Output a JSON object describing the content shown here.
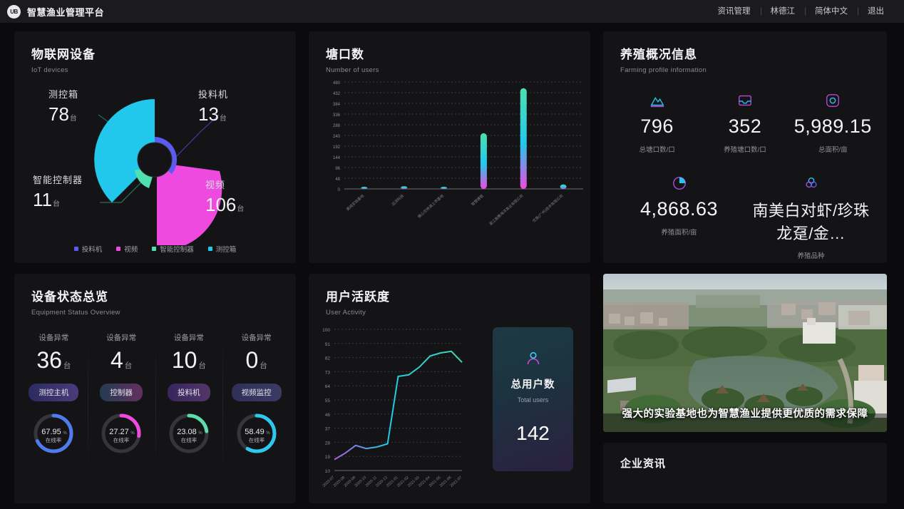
{
  "topbar": {
    "logo_text": "UB",
    "title": "智慧渔业管理平台",
    "nav": [
      {
        "label": "资讯管理",
        "name": "nav-news-management"
      },
      {
        "label": "林德江",
        "name": "nav-user-name"
      },
      {
        "label": "简体中文",
        "name": "nav-language"
      },
      {
        "label": "退出",
        "name": "nav-logout"
      }
    ]
  },
  "iot": {
    "title": "物联网设备",
    "subtitle": "IoT devices",
    "unit": "台",
    "labels": [
      {
        "name": "测控箱",
        "value": "78"
      },
      {
        "name": "投料机",
        "value": "13"
      },
      {
        "name": "智能控制器",
        "value": "11"
      },
      {
        "name": "视频",
        "value": "106"
      }
    ],
    "legend": [
      {
        "label": "投料机",
        "color": "#5b5bf0"
      },
      {
        "label": "视频",
        "color": "#ef4ae0"
      },
      {
        "label": "智能控制器",
        "color": "#4fe0b0"
      },
      {
        "label": "测控箱",
        "color": "#22c8ec"
      }
    ],
    "chart_data": {
      "type": "pie",
      "title": "物联网设备 / IoT devices",
      "labels": [
        "测控箱",
        "视频",
        "投料机",
        "智能控制器"
      ],
      "values": [
        78,
        106,
        13,
        11
      ],
      "unit": "台",
      "colors": [
        "#22c8ec",
        "#ef4ae0",
        "#5b5bf0",
        "#4fe0b0"
      ],
      "legend_position": "bottom"
    }
  },
  "ponds": {
    "title": "塘口数",
    "subtitle": "Number of users",
    "chart_data": {
      "type": "bar",
      "title": "塘口数",
      "categories": [
        "美纯实验基地",
        "远洋科技",
        "佛山农林湖上学基地",
        "智慧塘租",
        "湛江南惠海洋渔业有限公司",
        "优鱼(广州)技术有限公司"
      ],
      "values": [
        6,
        12,
        8,
        250,
        452,
        20
      ],
      "xlabel": "",
      "ylabel": "",
      "ylim": [
        0,
        480
      ],
      "yticks": [
        0,
        48,
        96,
        144,
        192,
        240,
        288,
        336,
        384,
        432,
        480
      ],
      "grid": true,
      "bar_gradient": [
        "#ef4ae0",
        "#22c8ec",
        "#4fe0b0"
      ]
    }
  },
  "farming": {
    "title": "养殖概况信息",
    "subtitle": "Farming profile information",
    "stats": [
      {
        "icon": "mountain-icon",
        "value": "796",
        "caption": "总塘口数/口"
      },
      {
        "icon": "inbox-icon",
        "value": "352",
        "caption": "养殖塘口数/口"
      },
      {
        "icon": "camera-icon",
        "value": "5,989.15",
        "caption": "总面积/亩"
      },
      {
        "icon": "pie-icon",
        "value": "4,868.63",
        "caption": "养殖面积/亩"
      },
      {
        "icon": "clover-icon",
        "value": "南美白对虾/珍珠龙趸/金…",
        "caption": "养殖品种"
      }
    ]
  },
  "equipment": {
    "title": "设备状态总览",
    "subtitle": "Equipment Status Overview",
    "unit": "台",
    "columns": [
      {
        "caption": "设备异常",
        "value": "36",
        "chip": "测控主机",
        "percent": "67.95",
        "percent_unit": "%",
        "rate_label": "在线率",
        "color": "#4f7bf0",
        "pct_num": 67.95
      },
      {
        "caption": "设备异常",
        "value": "4",
        "chip": "控制器",
        "percent": "27.27",
        "percent_unit": "%",
        "rate_label": "在线率",
        "color": "#ef4ae0",
        "pct_num": 27.27
      },
      {
        "caption": "设备异常",
        "value": "10",
        "chip": "投料机",
        "percent": "23.08",
        "percent_unit": "%",
        "rate_label": "在线率",
        "color": "#5fdcab",
        "pct_num": 23.08
      },
      {
        "caption": "设备异常",
        "value": "0",
        "chip": "视频监控",
        "percent": "58.49",
        "percent_unit": "%",
        "rate_label": "在线率",
        "color": "#2ec8ee",
        "pct_num": 58.49
      }
    ]
  },
  "activity": {
    "title": "用户活跃度",
    "subtitle": "User Activity",
    "total_users": {
      "icon": "user-icon",
      "title": "总用户数",
      "subtitle": "Total users",
      "value": "142"
    },
    "chart_data": {
      "type": "line",
      "title": "用户活跃度 / User Activity",
      "x": [
        "2020-07",
        "2020-08",
        "2020-09",
        "2020-10",
        "2020-11",
        "2020-12",
        "2021-01",
        "2021-02",
        "2021-03",
        "2021-04",
        "2021-05",
        "2021-06",
        "2021-07"
      ],
      "values": [
        17,
        21,
        26,
        24,
        25,
        27,
        70,
        71,
        76,
        83,
        85,
        86,
        79
      ],
      "ylim": [
        10,
        100
      ],
      "yticks": [
        10,
        19,
        28,
        37,
        46,
        55,
        64,
        73,
        82,
        91,
        100
      ],
      "grid": true,
      "line_gradient": [
        "#b05be0",
        "#22c8ec",
        "#3fd9ad"
      ]
    }
  },
  "photo": {
    "caption": "强大的实验基地也为智慧渔业提供更优质的需求保障",
    "alt": "aerial-view-of-fishery-base"
  },
  "news": {
    "title": "企业资讯"
  }
}
